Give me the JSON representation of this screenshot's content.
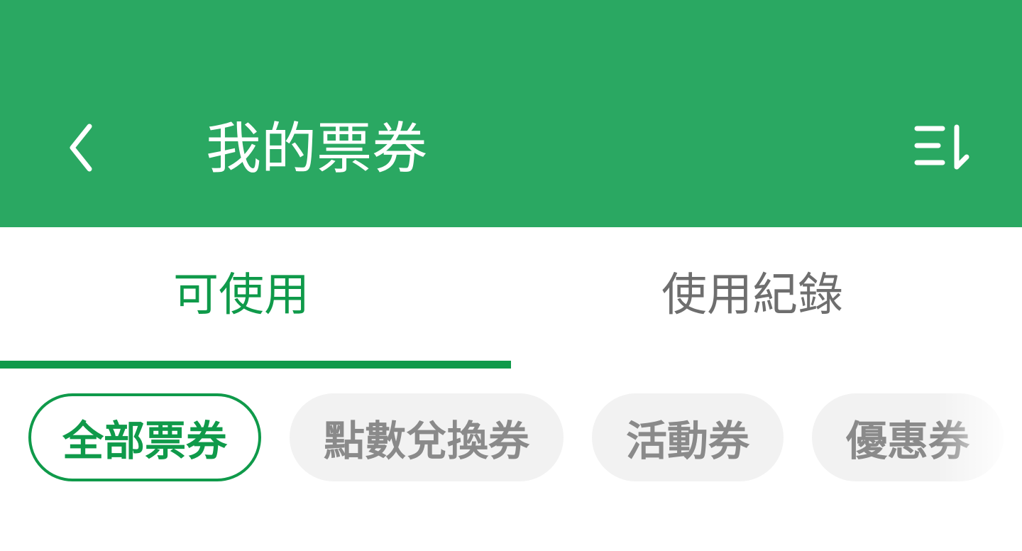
{
  "header": {
    "title": "我的票券",
    "back_icon": "chevron-left-icon",
    "sort_icon": "sort-icon",
    "background_color": "#2aa862"
  },
  "tabs": [
    {
      "label": "可使用",
      "active": true
    },
    {
      "label": "使用紀錄",
      "active": false
    }
  ],
  "filters": [
    {
      "label": "全部票券",
      "active": true
    },
    {
      "label": "點數兌換券",
      "active": false
    },
    {
      "label": "活動券",
      "active": false
    },
    {
      "label": "優惠券",
      "active": false
    }
  ],
  "colors": {
    "accent": "#0f9a4a",
    "inactive_text": "#6e6e6e",
    "chip_background": "#f2f2f2"
  }
}
